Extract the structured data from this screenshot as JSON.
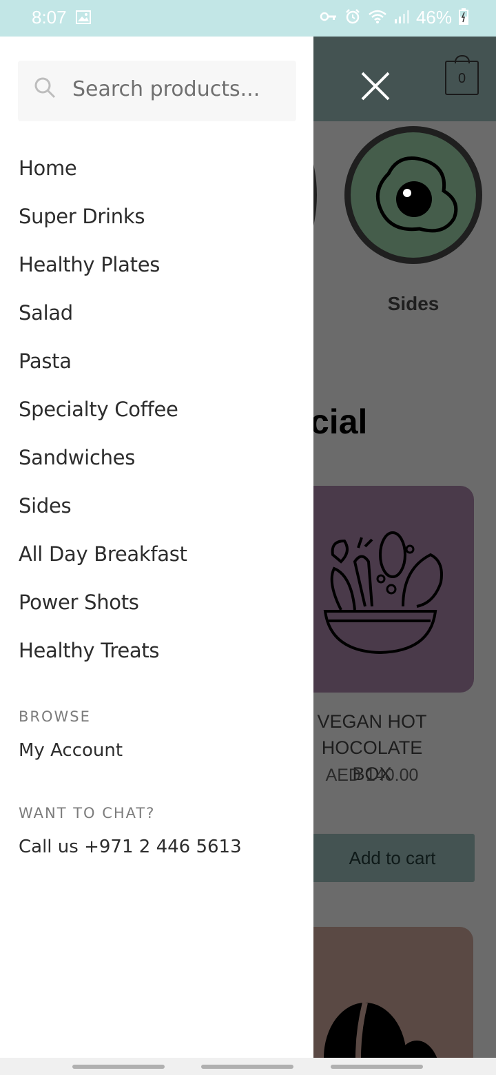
{
  "status_bar": {
    "time": "8:07",
    "battery_percent": "46%",
    "icons": [
      "image-icon",
      "key-icon",
      "alarm-icon",
      "wifi-icon",
      "signal-icon",
      "battery-icon"
    ]
  },
  "search": {
    "placeholder": "Search products..."
  },
  "menu": {
    "items": [
      {
        "label": "Home"
      },
      {
        "label": "Super Drinks"
      },
      {
        "label": "Healthy Plates"
      },
      {
        "label": "Salad"
      },
      {
        "label": "Pasta"
      },
      {
        "label": "Specialty Coffee"
      },
      {
        "label": "Sandwiches"
      },
      {
        "label": "Sides"
      },
      {
        "label": "All Day Breakfast"
      },
      {
        "label": "Power Shots"
      },
      {
        "label": "Healthy Treats"
      }
    ]
  },
  "browse": {
    "title": "BROWSE",
    "account_label": "My Account"
  },
  "chat": {
    "title": "WANT TO CHAT?",
    "call_label": "Call us +971 2 446 5613"
  },
  "background": {
    "cart_count": "0",
    "category_label": "Sides",
    "section_heading_partial": "cial",
    "product": {
      "title_line1": "VEGAN HOT",
      "title_line2": "HOCOLATE BOX",
      "price": "AED 140.00",
      "add_to_cart": "Add to cart"
    }
  },
  "colors": {
    "status_bar": "#c2e6e6",
    "header_dark": "#445352",
    "overlay": "#6b6b6b",
    "category_circle": "#455d4b",
    "card_purple": "#4a3a4a",
    "card_brown": "#5a4944"
  }
}
